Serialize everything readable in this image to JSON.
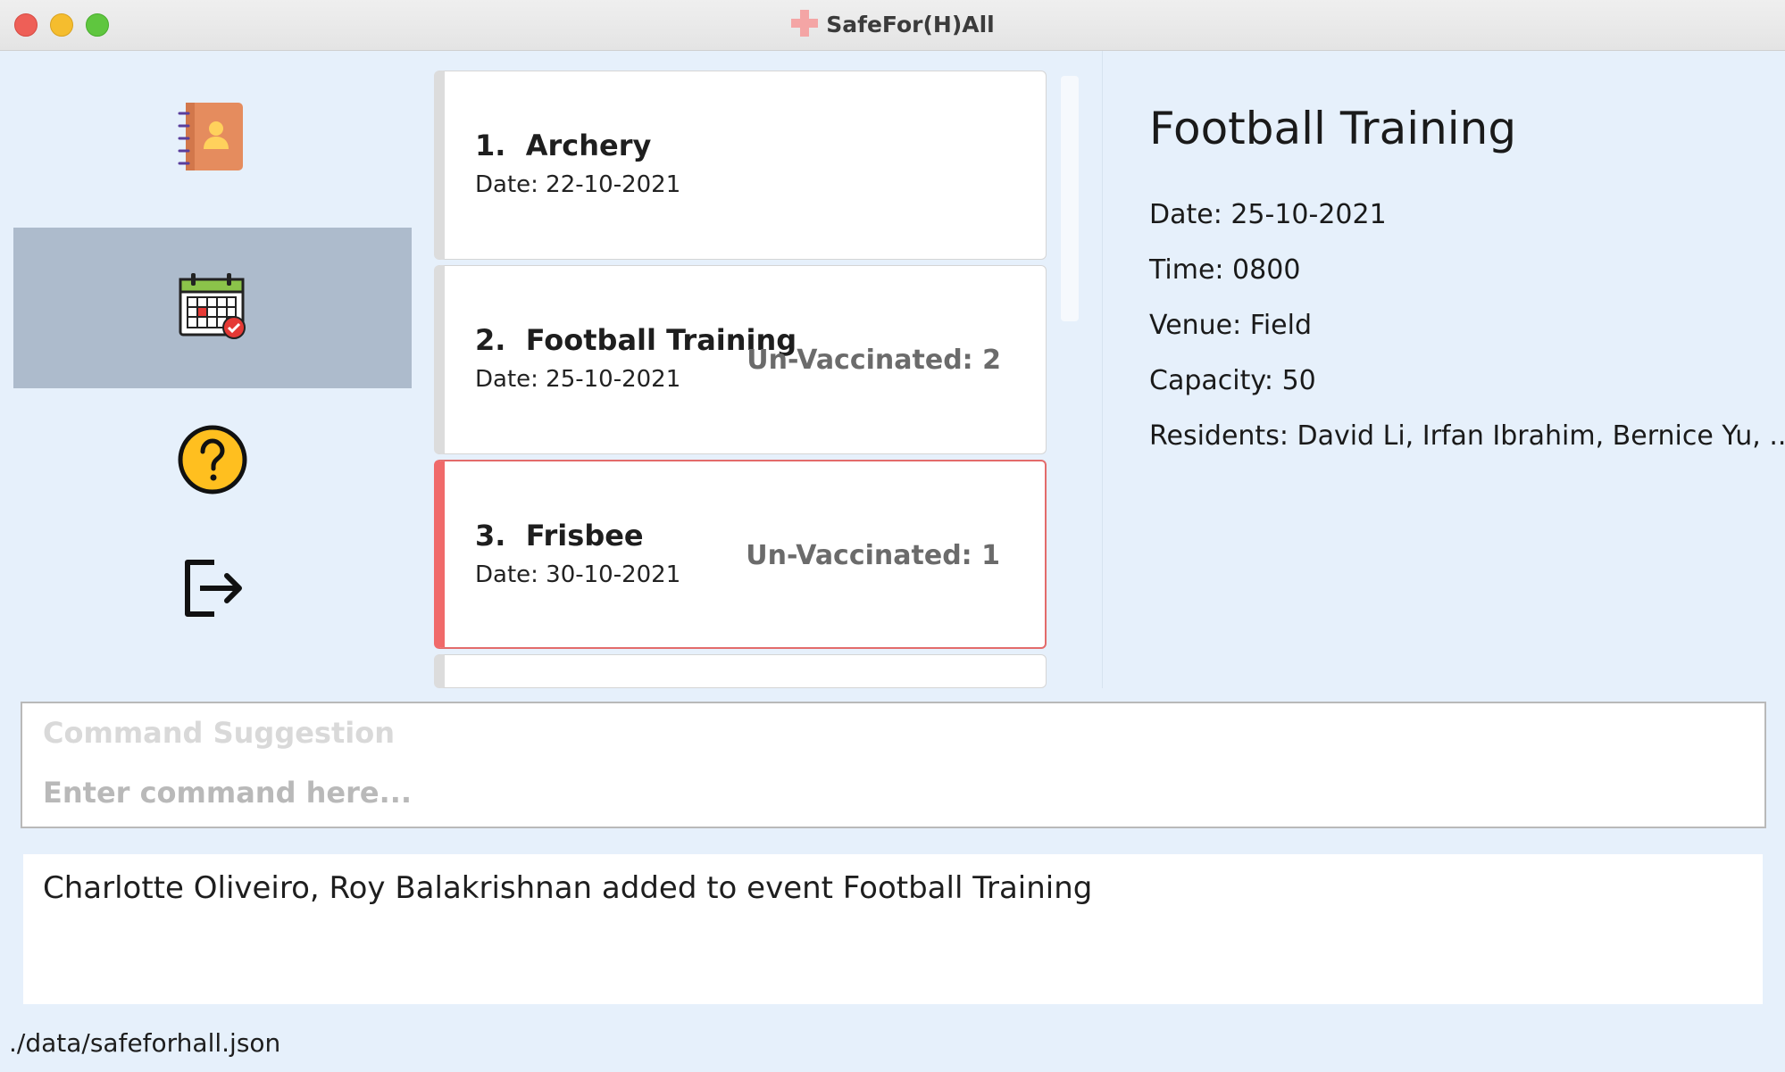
{
  "window": {
    "title": "SafeFor(H)All"
  },
  "sidebar": {
    "items": [
      {
        "id": "residents",
        "icon": "address-book-icon"
      },
      {
        "id": "events",
        "icon": "calendar-icon",
        "active": true
      },
      {
        "id": "help",
        "icon": "help-icon"
      },
      {
        "id": "exit",
        "icon": "exit-icon"
      }
    ]
  },
  "events": [
    {
      "index": "1.",
      "name": "Archery",
      "date": "Date: 22-10-2021",
      "unvaccinated": ""
    },
    {
      "index": "2.",
      "name": "Football Training",
      "date": "Date: 25-10-2021",
      "unvaccinated": "Un-Vaccinated: 2"
    },
    {
      "index": "3.",
      "name": "Frisbee",
      "date": "Date: 30-10-2021",
      "unvaccinated": "Un-Vaccinated: 1"
    }
  ],
  "details": {
    "title": "Football Training",
    "date": "Date: 25-10-2021",
    "time": "Time: 0800",
    "venue": "Venue: Field",
    "capacity": "Capacity: 50",
    "residents": "Residents: David Li, Irfan Ibrahim, Bernice Yu, ..."
  },
  "command": {
    "suggestion": "Command Suggestion",
    "placeholder": "Enter command here...",
    "value": ""
  },
  "result": {
    "message": "Charlotte Oliveiro, Roy Balakrishnan added to event Football Training"
  },
  "status": {
    "path": "./data/safeforhall.json"
  },
  "colors": {
    "accent": "#f06a6a",
    "sidebar_active": "#adbbcc",
    "background": "#e6f0fb"
  }
}
